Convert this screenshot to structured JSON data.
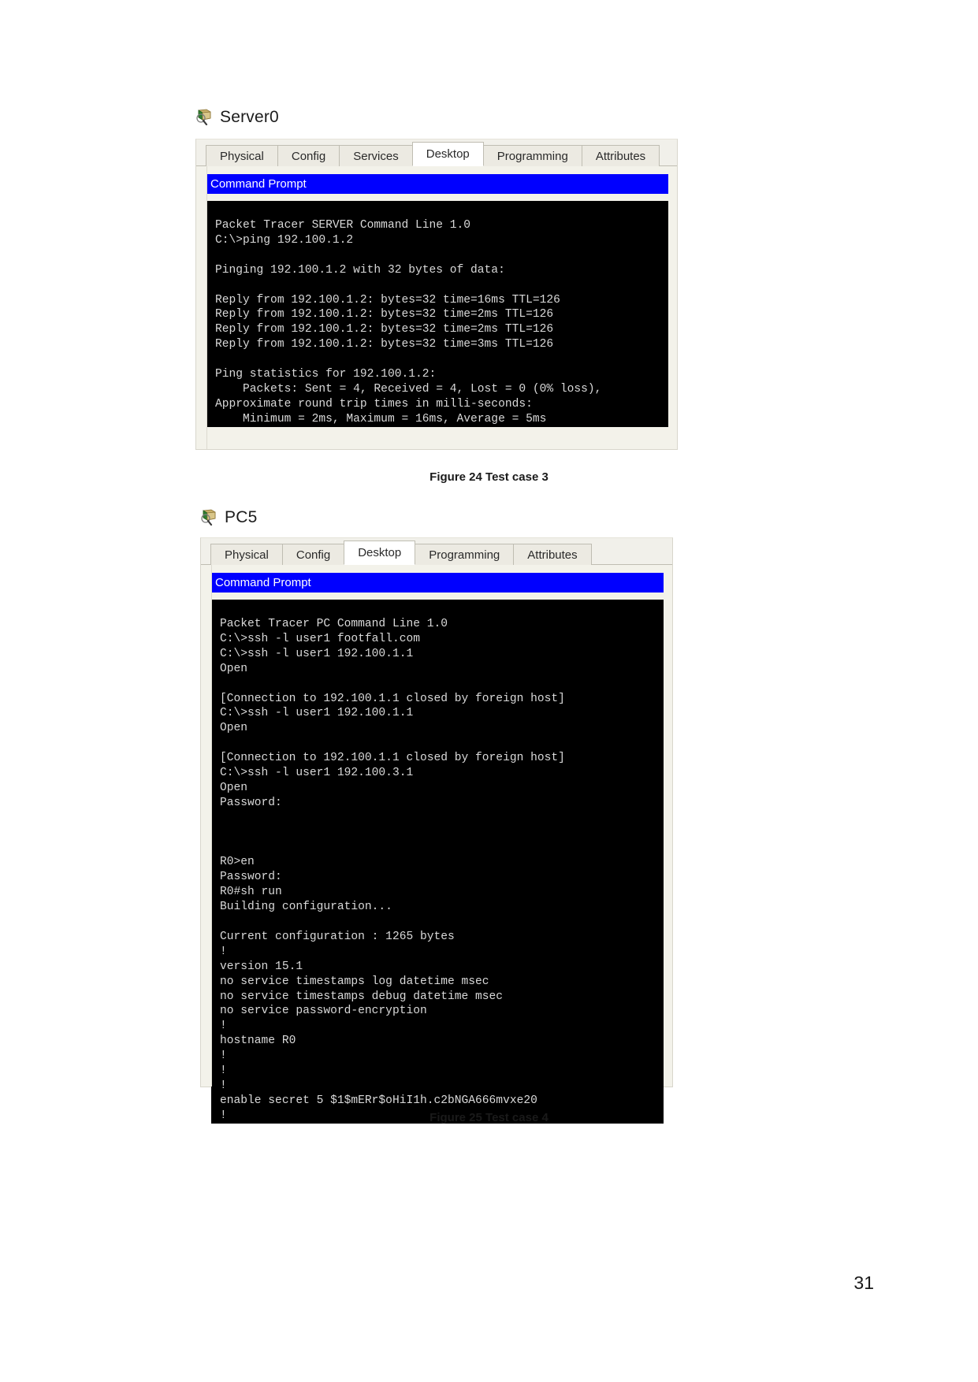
{
  "page": {
    "number": "31"
  },
  "figures": [
    {
      "device_label": "Server0",
      "device_icon": "server-device-icon",
      "tabs": [
        {
          "label": "Physical",
          "active": false
        },
        {
          "label": "Config",
          "active": false
        },
        {
          "label": "Services",
          "active": false
        },
        {
          "label": "Desktop",
          "active": true
        },
        {
          "label": "Programming",
          "active": false
        },
        {
          "label": "Attributes",
          "active": false
        }
      ],
      "window_title": "Command Prompt",
      "terminal_lines": [
        "Packet Tracer SERVER Command Line 1.0",
        "C:\\>ping 192.100.1.2",
        "",
        "Pinging 192.100.1.2 with 32 bytes of data:",
        "",
        "Reply from 192.100.1.2: bytes=32 time=16ms TTL=126",
        "Reply from 192.100.1.2: bytes=32 time=2ms TTL=126",
        "Reply from 192.100.1.2: bytes=32 time=2ms TTL=126",
        "Reply from 192.100.1.2: bytes=32 time=3ms TTL=126",
        "",
        "Ping statistics for 192.100.1.2:",
        "    Packets: Sent = 4, Received = 4, Lost = 0 (0% loss),",
        "Approximate round trip times in milli-seconds:",
        "    Minimum = 2ms, Maximum = 16ms, Average = 5ms"
      ],
      "caption": "Figure 24 Test case 3"
    },
    {
      "device_label": "PC5",
      "device_icon": "pc-device-icon",
      "tabs": [
        {
          "label": "Physical",
          "active": false
        },
        {
          "label": "Config",
          "active": false
        },
        {
          "label": "Desktop",
          "active": true
        },
        {
          "label": "Programming",
          "active": false
        },
        {
          "label": "Attributes",
          "active": false
        }
      ],
      "window_title": "Command Prompt",
      "terminal_lines": [
        "Packet Tracer PC Command Line 1.0",
        "C:\\>ssh -l user1 footfall.com",
        "C:\\>ssh -l user1 192.100.1.1",
        "Open",
        "",
        "[Connection to 192.100.1.1 closed by foreign host]",
        "C:\\>ssh -l user1 192.100.1.1",
        "Open",
        "",
        "[Connection to 192.100.1.1 closed by foreign host]",
        "C:\\>ssh -l user1 192.100.3.1",
        "Open",
        "Password:",
        "",
        "",
        "",
        "R0>en",
        "Password:",
        "R0#sh run",
        "Building configuration...",
        "",
        "Current configuration : 1265 bytes",
        "!",
        "version 15.1",
        "no service timestamps log datetime msec",
        "no service timestamps debug datetime msec",
        "no service password-encryption",
        "!",
        "hostname R0",
        "!",
        "!",
        "!",
        "enable secret 5 $1$mERr$oHiI1h.c2bNGA666mvxe20",
        "!"
      ],
      "caption": "Figure 25 Test case 4"
    }
  ],
  "colors": {
    "titlebar_background": "#0000ff",
    "titlebar_text": "#ffffff",
    "terminal_background": "#000000",
    "terminal_text": "#d9d9d9",
    "panel_background": "#f3f2ea",
    "tab_active_background": "#ffffff"
  }
}
